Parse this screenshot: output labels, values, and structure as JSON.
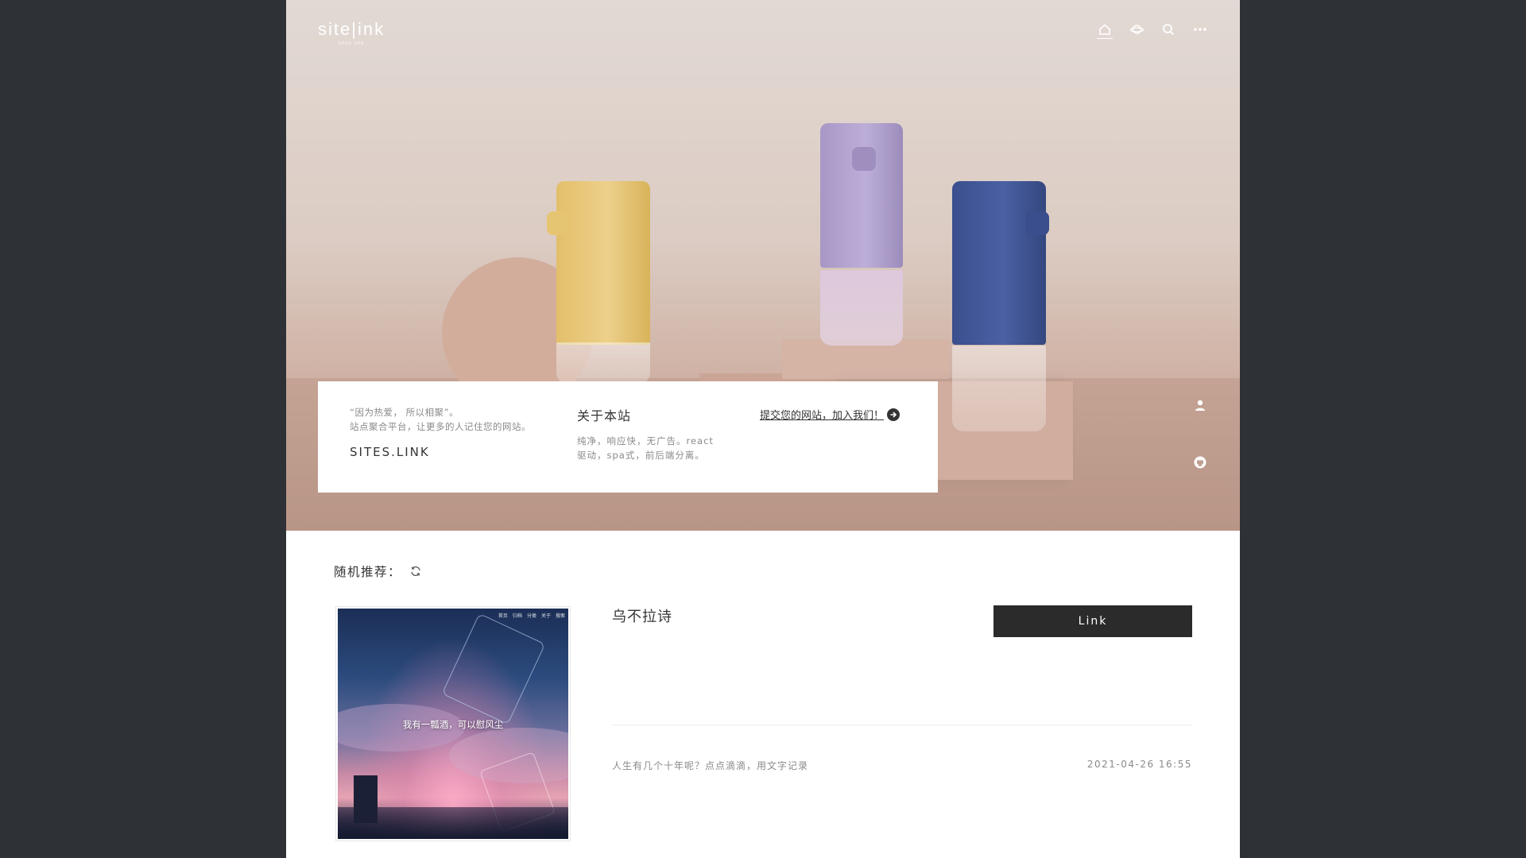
{
  "header": {
    "logo_text": "site|ink",
    "logo_sub": "sites link",
    "nav_icons": [
      "home-icon",
      "planet-icon",
      "search-icon",
      "more-icon"
    ]
  },
  "side_icons": [
    "user-icon",
    "github-icon"
  ],
  "about": {
    "quote_line1": "“因为热爱， 所以相聚”。",
    "quote_line2": "站点聚合平台，让更多的人记住您的网站。",
    "site_name": "SITES.LINK",
    "title": "关于本站",
    "desc_line1": "纯净，响应快，无广告。react",
    "desc_line2": "驱动，spa式，前后端分离。",
    "submit_label": "提交您的网站，加入我们！"
  },
  "random": {
    "label": "随机推荐：",
    "card": {
      "title": "乌不拉诗",
      "link_label": "Link",
      "description": "人生有几个十年呢？点点滴滴，用文字记录",
      "date": "2021-04-26 16:55",
      "thumbnail_slogan": "我有一瓢酒，可以慰风尘",
      "thumbnail_nav": [
        "首页",
        "归档",
        "分类",
        "关于",
        "搜索"
      ]
    }
  },
  "colors": {
    "page_bg": "#2e3135",
    "button_bg": "#2b2b2b",
    "text_muted": "#8a8a8a"
  }
}
